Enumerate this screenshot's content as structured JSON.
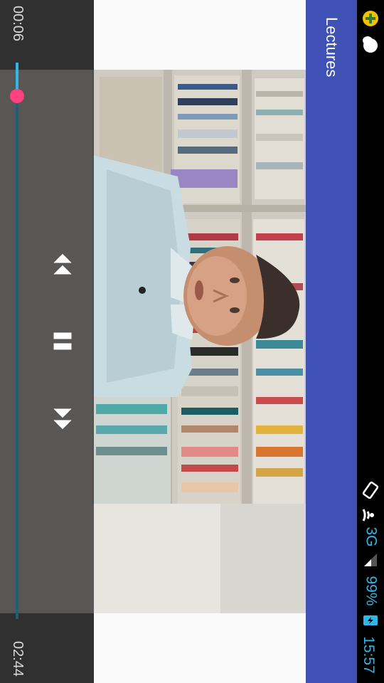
{
  "status_bar": {
    "time": "15:57",
    "battery_percent": "99%",
    "network_type": "3G",
    "icons": [
      "plus-badge-icon",
      "cloud-icon",
      "screen-rotate-icon",
      "wifi-icon",
      "signal-icon",
      "battery-charging-icon"
    ],
    "accent_color": "#33b5e5"
  },
  "app_bar": {
    "title": "Lectures",
    "color": "#3f51b5"
  },
  "player": {
    "elapsed": "00:06",
    "duration": "02:44",
    "progress_fraction": 0.037,
    "state": "playing",
    "controls": {
      "rewind": "rewind-icon",
      "pause": "pause-icon",
      "fast_forward": "fast-forward-icon"
    },
    "accent_color": "#33b5e5",
    "thumb_color": "#ff4081"
  }
}
